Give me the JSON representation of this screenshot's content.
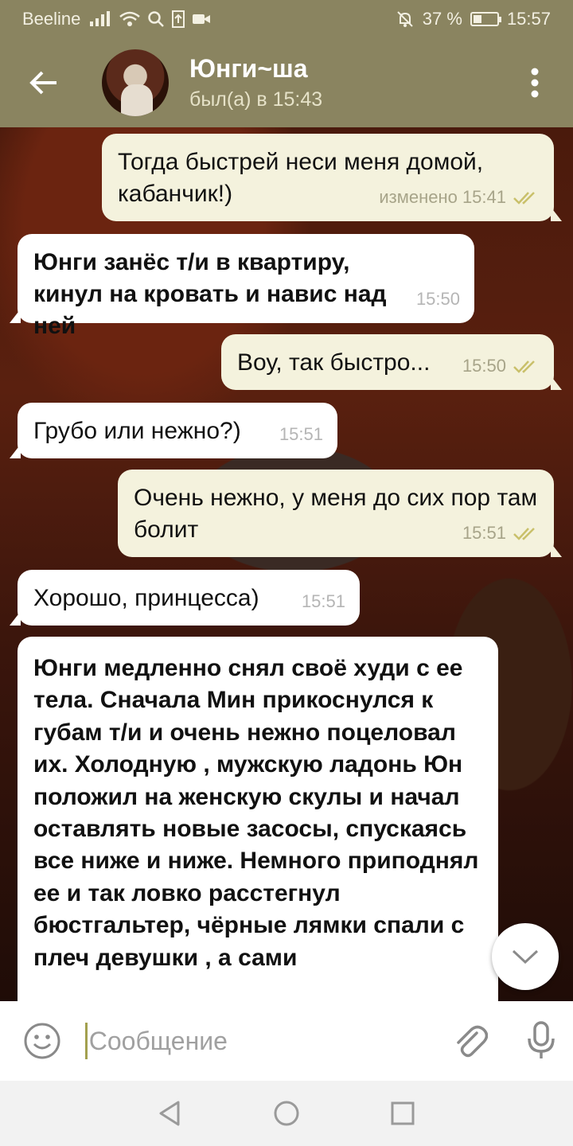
{
  "status_bar": {
    "carrier": "Beeline",
    "battery_percent": "37 %",
    "battery_level": 0.37,
    "time": "15:57"
  },
  "header": {
    "contact_name": "Юнги~ша",
    "last_seen": "был(а) в 15:43"
  },
  "messages": [
    {
      "dir": "out",
      "text": "Тогда быстрей неси меня домой, кабанчик!)",
      "meta": "изменено 15:41",
      "read": true
    },
    {
      "dir": "in",
      "bold": true,
      "text": "Юнги занёс т/и в квартиру, кинул на кровать и навис над ней",
      "meta": "15:50"
    },
    {
      "dir": "out",
      "text": "Воу, так быстро...",
      "meta": "15:50",
      "read": true
    },
    {
      "dir": "in",
      "text": "Грубо или нежно?)",
      "meta": "15:51"
    },
    {
      "dir": "out",
      "text": "Очень нежно, у меня до сих пор там болит",
      "meta": "15:51",
      "read": true
    },
    {
      "dir": "in",
      "text": "Хорошо, принцесса)",
      "meta": "15:51"
    },
    {
      "dir": "in",
      "bold": true,
      "text": "Юнги медленно снял своё худи с ее тела. Сначала Мин прикоснулся к губам т/и и очень нежно поцеловал их. Холодную , мужскую ладонь Юн положил на женскую скулы и начал оставлять новые засосы, спускаясь все ниже и ниже. Немного приподнял ее и так ловко расстегнул бюстгальтер, чёрные лямки спали с плеч девушки , а сами",
      "meta": ""
    }
  ],
  "input": {
    "placeholder": "Сообщение"
  },
  "colors": {
    "header_bg": "#8a8460",
    "out_bubble": "#f4f2dd",
    "in_bubble": "#ffffff",
    "check_color": "#c9c06a"
  }
}
